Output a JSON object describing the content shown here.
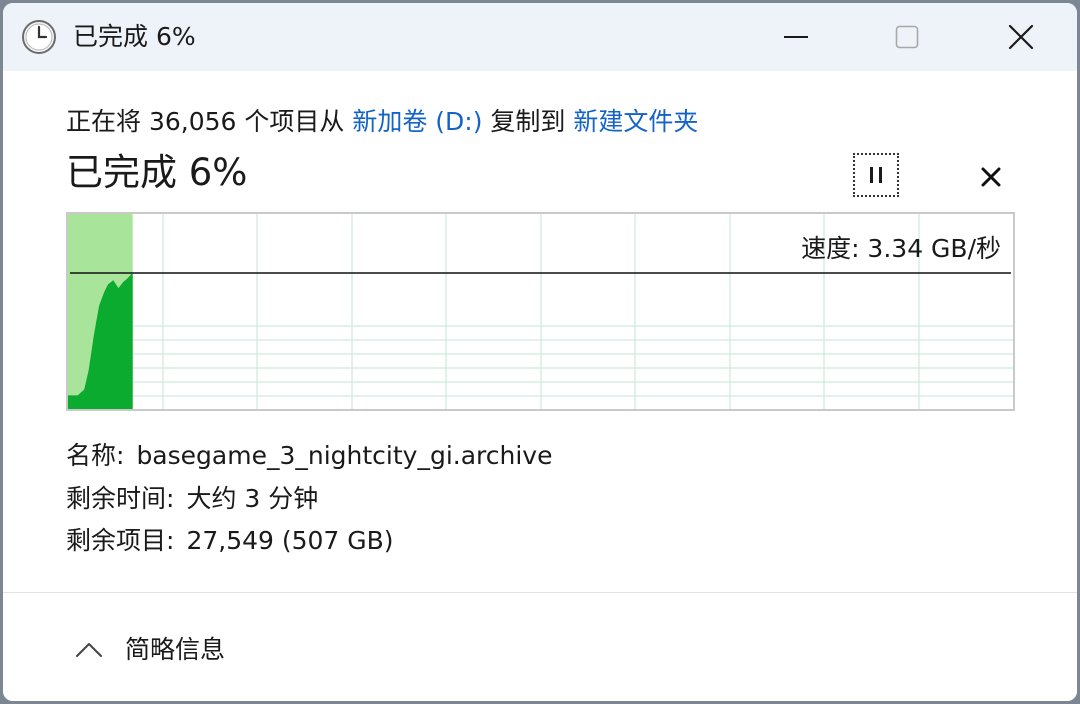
{
  "window": {
    "title": "已完成 6%",
    "icon": "clock-icon",
    "controls": {
      "minimize_icon": "minimize-icon",
      "maximize_icon": "maximize-icon",
      "close_icon": "close-icon"
    }
  },
  "copy": {
    "prefix": "正在将 36,056 个项目从 ",
    "source": "新加卷 (D:)",
    "middle": " 复制到 ",
    "destination": "新建文件夹"
  },
  "status": {
    "title": "已完成 6%",
    "progress_percent": 6,
    "pause_icon": "pause-icon",
    "cancel_icon": "cancel-x-icon"
  },
  "graph": {
    "speed_label": "速度: 3.34 GB/秒",
    "fill_color": "#0aab2e",
    "progress_color": "#a8e59b",
    "grid_color": "#cfeadd"
  },
  "details": {
    "name_label": "名称:",
    "name_value": "basegame_3_nightcity_gi.archive",
    "time_label": "剩余时间:",
    "time_value": "大约 3 分钟",
    "items_label": "剩余项目:",
    "items_value": "27,549 (507 GB)"
  },
  "footer": {
    "toggle_label": "简略信息",
    "toggle_icon": "chevron-up-icon"
  }
}
